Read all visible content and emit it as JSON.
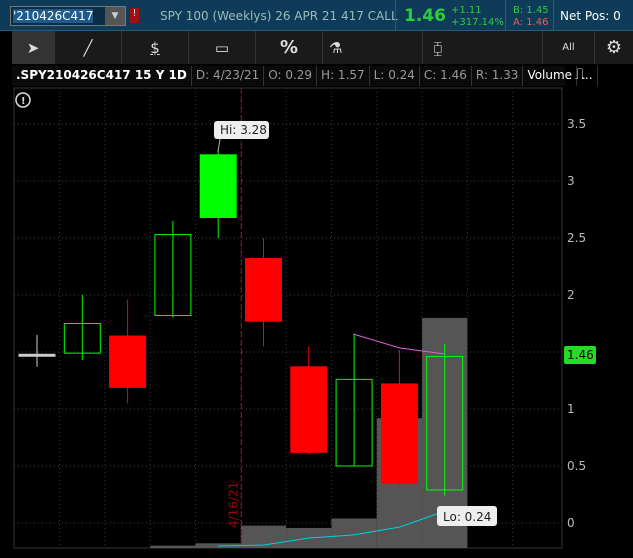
{
  "header": {
    "symbol": "'210426C417",
    "description": "SPY 100 (Weeklys) 26 APR 21 417 CALL",
    "last": "1.46",
    "change": "+1.11",
    "change_pct": "+317.14%",
    "bid": "B: 1.45",
    "ask": "A: 1.46",
    "net_pos": "Net Pos: 0",
    "alert_label": "!"
  },
  "toolbar": {
    "all_label": "All",
    "percent_label": "%",
    "dollar_label": "$"
  },
  "info": {
    "symbol": ".SPY210426C417 15 Y 1D",
    "date": "D: 4/23/21",
    "open": "O: 0.29",
    "high": "H: 1.57",
    "low": "L: 0.24",
    "close": "C: 1.46",
    "range": "R: 1.33",
    "volume": "Volume",
    "more": "..."
  },
  "chart_data": {
    "type": "candlestick",
    "yticks": [
      "0",
      "0.5",
      "1",
      "1.5",
      "2",
      "2.5",
      "3",
      "3.5"
    ],
    "ylim": [
      -0.2,
      3.65
    ],
    "candles": [
      {
        "o": 1.47,
        "h": 1.65,
        "l": 1.37,
        "c": 1.48
      },
      {
        "o": 1.49,
        "h": 2.0,
        "l": 1.43,
        "c": 1.75
      },
      {
        "o": 1.64,
        "h": 1.96,
        "l": 1.05,
        "c": 1.19
      },
      {
        "o": 1.82,
        "h": 2.65,
        "l": 1.8,
        "c": 2.53
      },
      {
        "o": 2.68,
        "h": 3.28,
        "l": 2.5,
        "c": 3.23
      },
      {
        "o": 2.32,
        "h": 2.5,
        "l": 1.55,
        "c": 1.77
      },
      {
        "o": 1.37,
        "h": 1.55,
        "l": 0.6,
        "c": 0.62
      },
      {
        "o": 0.5,
        "h": 1.65,
        "l": 0.5,
        "c": 1.26
      },
      {
        "o": 1.22,
        "h": 1.52,
        "l": 0.32,
        "c": 0.35
      },
      {
        "o": 0.29,
        "h": 1.57,
        "l": 0.24,
        "c": 1.46
      }
    ],
    "volume_rel": [
      0,
      0,
      0,
      0.02,
      0.04,
      0.19,
      0.17,
      0.25,
      1.1,
      1.95
    ],
    "last_label": "1.46",
    "hi_label": "Hi: 3.28",
    "lo_label": "Lo: 0.24",
    "date_marker": "4/16/21",
    "colors": {
      "up": "#00ff00",
      "down": "#ff0000",
      "volume": "#555555",
      "ma1": "#e060e0",
      "ma2": "#00d0e0"
    }
  }
}
